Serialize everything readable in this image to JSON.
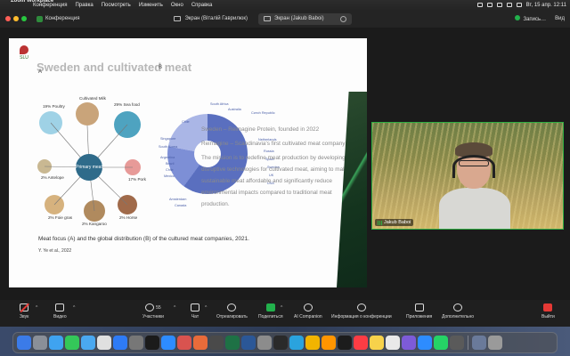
{
  "menubar": {
    "app": "Zoom Workplace",
    "items": [
      "Конференция",
      "Правка",
      "Посмотреть",
      "Изменить",
      "Окно",
      "Справка"
    ],
    "datetime": "Вт, 15 апр.  12:11"
  },
  "zoombar": {
    "conference_label": "Конференция",
    "tabs": [
      {
        "label": "Экран (Віталій Гаврилюк)",
        "active": false
      },
      {
        "label": "Экран (Jakub Baboi)",
        "active": true
      }
    ],
    "record_label": "Запись…",
    "view_label": "Вид"
  },
  "slide": {
    "logo_text": "SLU",
    "title": "Sweden and cultivated meat",
    "panel_a": "A",
    "panel_b": "B",
    "hub_label": "Primary meat",
    "nodes": [
      "19% Poultry",
      "Cultivated Milk",
      "29% Sea food",
      "2% Antelope",
      "17% Pork",
      "2% Foie gras",
      "2% Horse",
      "2% Kangaroo"
    ],
    "countries": [
      "South Africa",
      "Australia",
      "Chile",
      "Singapore",
      "South Korea",
      "Argentina",
      "Brazil",
      "Chile",
      "Mexico",
      "Canada",
      "Amsterdam",
      "Czech Republic",
      "Netherlands",
      "Russia",
      "Spain",
      "Sweden",
      "UK",
      "USA"
    ],
    "text": [
      "Sweden – Reimagine Protein, founded in 2022",
      "Reimagine – Scandinavia's first cultivated meat company",
      "The mission is to redefine meat production by developing disruptive technologies for cultivated meat, aiming to make sustainable meat affordable and significantly reduce environmental impacts compared to traditional meat production."
    ],
    "caption": "Meat focus (A) and the global distribution (B) of the cultured meat companies, 2021.",
    "citation": "Y. Ye et al., 2022"
  },
  "participant": {
    "name": "Jakub Baboi"
  },
  "toolbar": {
    "audio": "Звук",
    "video": "Видео",
    "participants": "Участники",
    "participants_count": "55",
    "chat": "Чат",
    "react": "Отреагировать",
    "share": "Поделиться",
    "ai": "AI Companion",
    "info": "Информация о конференции",
    "apps": "Приложения",
    "more": "Дополнительно",
    "leave": "Выйти"
  },
  "colors": {
    "accent_green": "#22b14c",
    "leave_red": "#e53935",
    "slide_title": "#b7b7b7"
  }
}
